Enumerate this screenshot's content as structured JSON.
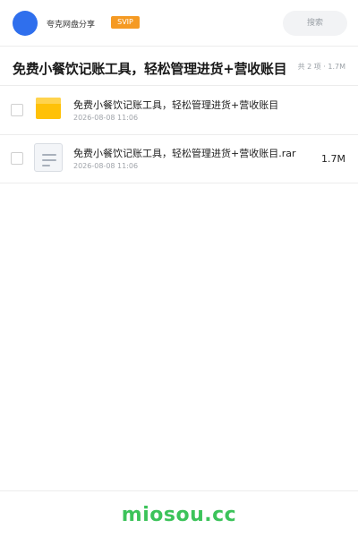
{
  "header": {
    "app_name": "夸克网盘分享",
    "vip_badge": "SVIP",
    "search_placeholder": "搜索",
    "avatar_color": "#2f6fed",
    "badge_color": "#f59a23"
  },
  "folder": {
    "title": "免费小餐饮记账工具，轻松管理进货+营收账目",
    "summary": "共 2 项 · 1.7M"
  },
  "files": [
    {
      "icon": "folder-icon",
      "name": "免费小餐饮记账工具，轻松管理进货+营收账目",
      "date": "2026-08-08 11:06",
      "size": ""
    },
    {
      "icon": "file-document-icon",
      "name": "免费小餐饮记账工具，轻松管理进货+营收账目.rar",
      "date": "2026-08-08 11:06",
      "size": "1.7M"
    }
  ],
  "footer": {
    "watermark": "miosou.cc",
    "watermark_color": "#3cc35a"
  }
}
